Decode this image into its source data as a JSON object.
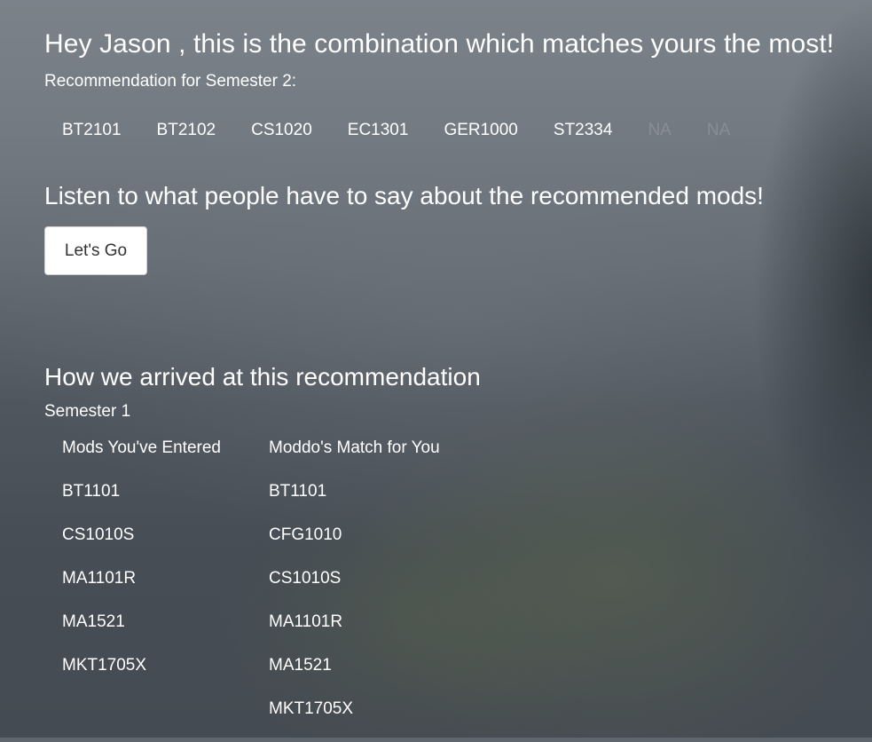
{
  "greeting": "Hey Jason , this is the combination which matches yours the most!",
  "recommendation_label": "Recommendation for Semester 2:",
  "recommended_mods": [
    "BT2101",
    "BT2102",
    "CS1020",
    "EC1301",
    "GER1000",
    "ST2334",
    "NA",
    "NA"
  ],
  "reviews_prompt": "Listen to what people have to say about the recommended mods!",
  "lets_go_button": "Let's Go",
  "explanation_title": "How we arrived at this recommendation",
  "semester_label": "Semester 1",
  "entered_header": "Mods You've Entered",
  "match_header": "Moddo's Match for You",
  "entered_mods": [
    "BT1101",
    "CS1010S",
    "MA1101R",
    "MA1521",
    "MKT1705X"
  ],
  "matched_mods": [
    "BT1101",
    "CFG1010",
    "CS1010S",
    "MA1101R",
    "MA1521",
    "MKT1705X"
  ]
}
